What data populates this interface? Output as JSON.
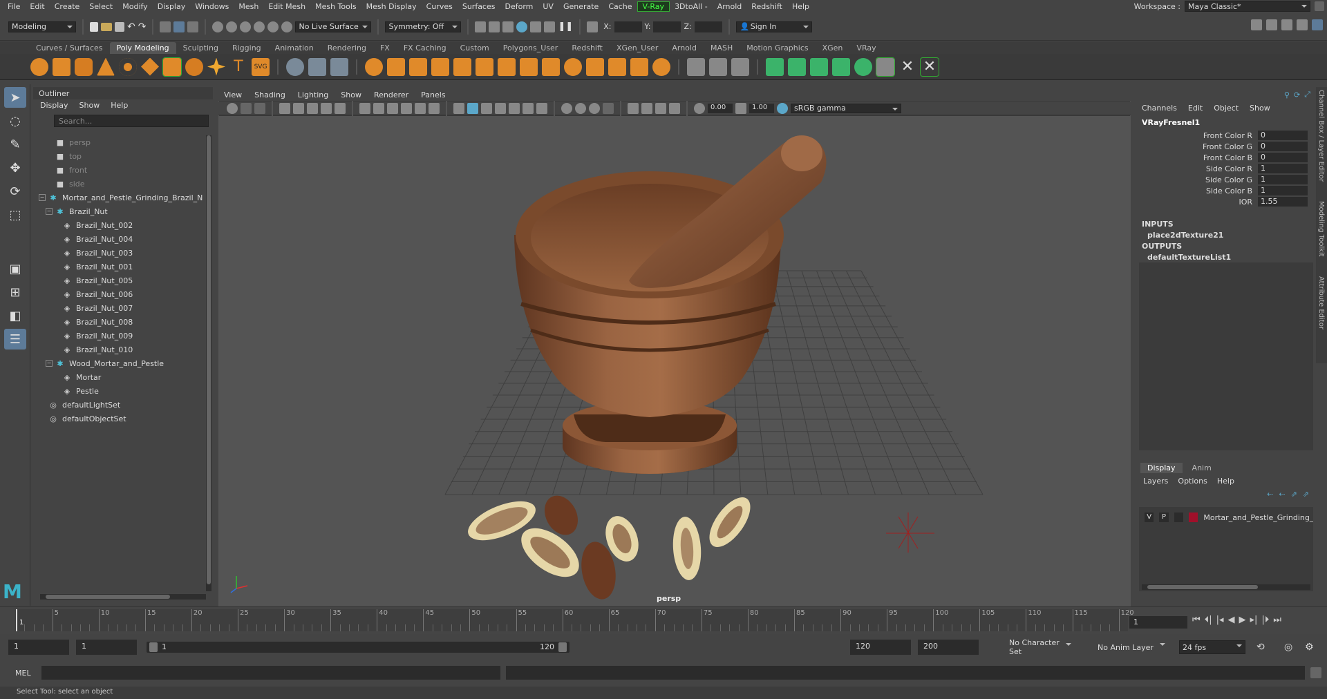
{
  "menubar": {
    "items": [
      "File",
      "Edit",
      "Create",
      "Select",
      "Modify",
      "Display",
      "Windows",
      "Mesh",
      "Edit Mesh",
      "Mesh Tools",
      "Mesh Display",
      "Curves",
      "Surfaces",
      "Deform",
      "UV",
      "Generate",
      "Cache",
      "V-Ray",
      "3DtoAll -",
      "Arnold",
      "Redshift",
      "Help"
    ],
    "workspace_label": "Workspace :",
    "workspace_value": "Maya Classic*"
  },
  "statusline": {
    "mode": "Modeling",
    "live_surface": "No Live Surface",
    "symmetry": "Symmetry: Off",
    "x_label": "X:",
    "y_label": "Y:",
    "z_label": "Z:",
    "sign_in": "Sign In"
  },
  "shelf": {
    "tabs": [
      "Curves / Surfaces",
      "Poly Modeling",
      "Sculpting",
      "Rigging",
      "Animation",
      "Rendering",
      "FX",
      "FX Caching",
      "Custom",
      "Polygons_User",
      "Redshift",
      "XGen_User",
      "Arnold",
      "MASH",
      "Motion Graphics",
      "XGen",
      "VRay"
    ],
    "active_tab": "Poly Modeling"
  },
  "outliner": {
    "title": "Outliner",
    "menu": [
      "Display",
      "Show",
      "Help"
    ],
    "search_placeholder": "Search...",
    "items": [
      {
        "label": "persp",
        "type": "camera",
        "indent": 1,
        "dim": true
      },
      {
        "label": "top",
        "type": "camera",
        "indent": 1,
        "dim": true
      },
      {
        "label": "front",
        "type": "camera",
        "indent": 1,
        "dim": true
      },
      {
        "label": "side",
        "type": "camera",
        "indent": 1,
        "dim": true
      },
      {
        "label": "Mortar_and_Pestle_Grinding_Brazil_N",
        "type": "group",
        "indent": 0,
        "expanded": true
      },
      {
        "label": "Brazil_Nut",
        "type": "group",
        "indent": 1,
        "expanded": true
      },
      {
        "label": "Brazil_Nut_002",
        "type": "mesh",
        "indent": 2
      },
      {
        "label": "Brazil_Nut_004",
        "type": "mesh",
        "indent": 2
      },
      {
        "label": "Brazil_Nut_003",
        "type": "mesh",
        "indent": 2
      },
      {
        "label": "Brazil_Nut_001",
        "type": "mesh",
        "indent": 2
      },
      {
        "label": "Brazil_Nut_005",
        "type": "mesh",
        "indent": 2
      },
      {
        "label": "Brazil_Nut_006",
        "type": "mesh",
        "indent": 2
      },
      {
        "label": "Brazil_Nut_007",
        "type": "mesh",
        "indent": 2
      },
      {
        "label": "Brazil_Nut_008",
        "type": "mesh",
        "indent": 2
      },
      {
        "label": "Brazil_Nut_009",
        "type": "mesh",
        "indent": 2
      },
      {
        "label": "Brazil_Nut_010",
        "type": "mesh",
        "indent": 2
      },
      {
        "label": "Wood_Mortar_and_Pestle",
        "type": "group",
        "indent": 1,
        "expanded": true
      },
      {
        "label": "Mortar",
        "type": "mesh",
        "indent": 2
      },
      {
        "label": "Pestle",
        "type": "mesh",
        "indent": 2
      },
      {
        "label": "defaultLightSet",
        "type": "set",
        "indent": 0
      },
      {
        "label": "defaultObjectSet",
        "type": "set",
        "indent": 0
      }
    ]
  },
  "viewport": {
    "menu": [
      "View",
      "Shading",
      "Lighting",
      "Show",
      "Renderer",
      "Panels"
    ],
    "exposure": "0.00",
    "gamma": "1.00",
    "colorspace": "sRGB gamma",
    "camera_label": "persp"
  },
  "channelbox": {
    "menu": [
      "Channels",
      "Edit",
      "Object",
      "Show"
    ],
    "node": "VRayFresnel1",
    "attrs": [
      {
        "label": "Front Color R",
        "value": "0"
      },
      {
        "label": "Front Color G",
        "value": "0"
      },
      {
        "label": "Front Color B",
        "value": "0"
      },
      {
        "label": "Side Color R",
        "value": "1"
      },
      {
        "label": "Side Color G",
        "value": "1"
      },
      {
        "label": "Side Color B",
        "value": "1"
      },
      {
        "label": "IOR",
        "value": "1.55"
      }
    ],
    "inputs_label": "INPUTS",
    "input": "place2dTexture21",
    "outputs_label": "OUTPUTS",
    "output": "defaultTextureList1"
  },
  "layereditor": {
    "tabs": [
      "Display",
      "Anim"
    ],
    "menu": [
      "Layers",
      "Options",
      "Help"
    ],
    "layer": {
      "v": "V",
      "p": "P",
      "name": "Mortar_and_Pestle_Grinding_B",
      "color": "#a0102a"
    }
  },
  "sidetabs": [
    "Channel Box / Layer Editor",
    "Modeling Toolkit",
    "Attribute Editor"
  ],
  "timeline": {
    "ticks": [
      5,
      10,
      15,
      20,
      25,
      30,
      35,
      40,
      45,
      50,
      55,
      60,
      65,
      70,
      75,
      80,
      85,
      90,
      95,
      100,
      105,
      110,
      115,
      120
    ],
    "current_marker": "1",
    "current_frame": "1"
  },
  "range": {
    "start": "1",
    "playback_start": "1",
    "slider_start": "1",
    "slider_end": "120",
    "playback_end": "120",
    "end": "200",
    "character_set": "No Character Set",
    "anim_layer": "No Anim Layer",
    "fps": "24 fps"
  },
  "cmdline": {
    "label": "MEL"
  },
  "helpline": {
    "text": "Select Tool: select an object"
  },
  "colors": {
    "accent": "#5d7b99",
    "wood": "#8b5a3a",
    "nut_shell": "#6b3a22",
    "nut_flesh": "#e6d7a8",
    "vray_green": "#44ff44"
  }
}
